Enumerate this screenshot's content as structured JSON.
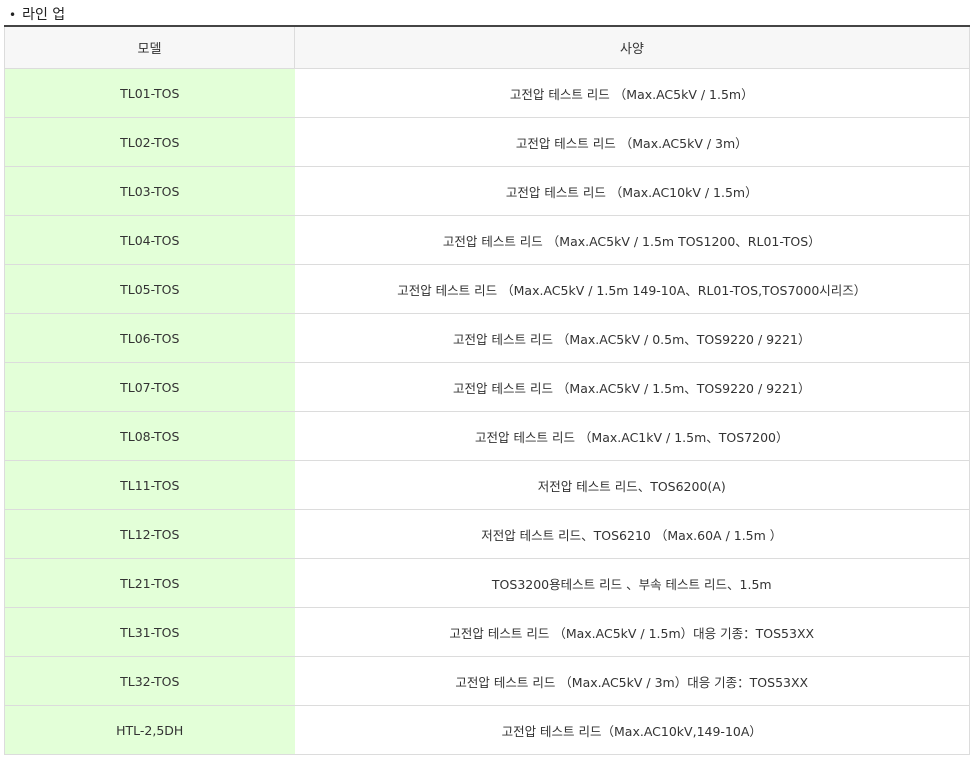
{
  "section": {
    "bullet": "•",
    "title": "라인 업"
  },
  "table": {
    "headers": {
      "model": "모델",
      "spec": "사양"
    },
    "rows": [
      {
        "model": "TL01-TOS",
        "spec": "고전압 테스트 리드 （Max.AC5kV / 1.5m）"
      },
      {
        "model": "TL02-TOS",
        "spec": "고전압 테스트 리드 （Max.AC5kV / 3m）"
      },
      {
        "model": "TL03-TOS",
        "spec": "고전압 테스트 리드 （Max.AC10kV / 1.5m）"
      },
      {
        "model": "TL04-TOS",
        "spec": "고전압 테스트 리드 （Max.AC5kV / 1.5m TOS1200、RL01-TOS）"
      },
      {
        "model": "TL05-TOS",
        "spec": "고전압 테스트 리드 （Max.AC5kV / 1.5m 149-10A、RL01-TOS,TOS7000시리즈）"
      },
      {
        "model": "TL06-TOS",
        "spec": "고전압 테스트 리드 （Max.AC5kV / 0.5m、TOS9220 / 9221）"
      },
      {
        "model": "TL07-TOS",
        "spec": "고전압 테스트 리드 （Max.AC5kV / 1.5m、TOS9220 / 9221）"
      },
      {
        "model": "TL08-TOS",
        "spec": "고전압 테스트 리드 （Max.AC1kV / 1.5m、TOS7200）"
      },
      {
        "model": "TL11-TOS",
        "spec": "저전압 테스트 리드、TOS6200(A)"
      },
      {
        "model": "TL12-TOS",
        "spec": "저전압 테스트 리드、TOS6210 （Max.60A / 1.5m ）"
      },
      {
        "model": "TL21-TOS",
        "spec": "TOS3200용테스트 리드 、부속 테스트 리드、1.5m"
      },
      {
        "model": "TL31-TOS",
        "spec": "고전압 테스트 리드 （Max.AC5kV / 1.5m）대응 기종：TOS53XX"
      },
      {
        "model": "TL32-TOS",
        "spec": "고전압 테스트 리드 （Max.AC5kV / 3m）대응 기종：TOS53XX"
      },
      {
        "model": "HTL-2,5DH",
        "spec": "고전압 테스트 리드（Max.AC10kV,149-10A）"
      }
    ]
  }
}
